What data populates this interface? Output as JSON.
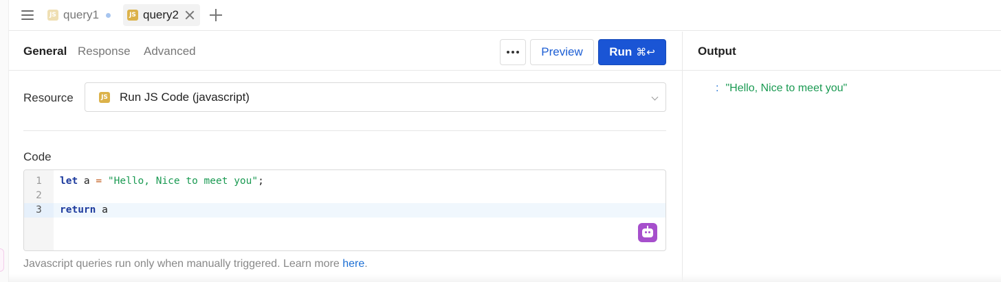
{
  "tabs": [
    {
      "label": "query1",
      "badge": "JS",
      "active": false,
      "unsaved": true
    },
    {
      "label": "query2",
      "badge": "JS",
      "active": true
    }
  ],
  "subtabs": [
    "General",
    "Response",
    "Advanced"
  ],
  "actions": {
    "preview_label": "Preview",
    "run_label": "Run",
    "run_shortcut": "⌘↩"
  },
  "resource": {
    "label": "Resource",
    "badge": "JS",
    "value": "Run JS Code (javascript)"
  },
  "code": {
    "label": "Code",
    "line_numbers": [
      "1",
      "2",
      "3"
    ],
    "lines": [
      {
        "kw": "let",
        "rest1": " a ",
        "op": "=",
        "str": "\"Hello, Nice to meet you\"",
        "rest2": ";"
      },
      {},
      {
        "kw": "return",
        "rest1": " a"
      }
    ]
  },
  "hint": {
    "text": "Javascript queries run only when manually triggered. Learn more ",
    "link": "here",
    "suffix": "."
  },
  "output": {
    "title": "Output",
    "colon": ":",
    "value": "\"Hello, Nice to meet you\""
  },
  "colors": {
    "run_button": "#1a55d5",
    "js_badge": "#dcb24a",
    "string": "#1a9a52",
    "keyword": "#1d3b9e",
    "ai_button": "#a64fcc"
  }
}
